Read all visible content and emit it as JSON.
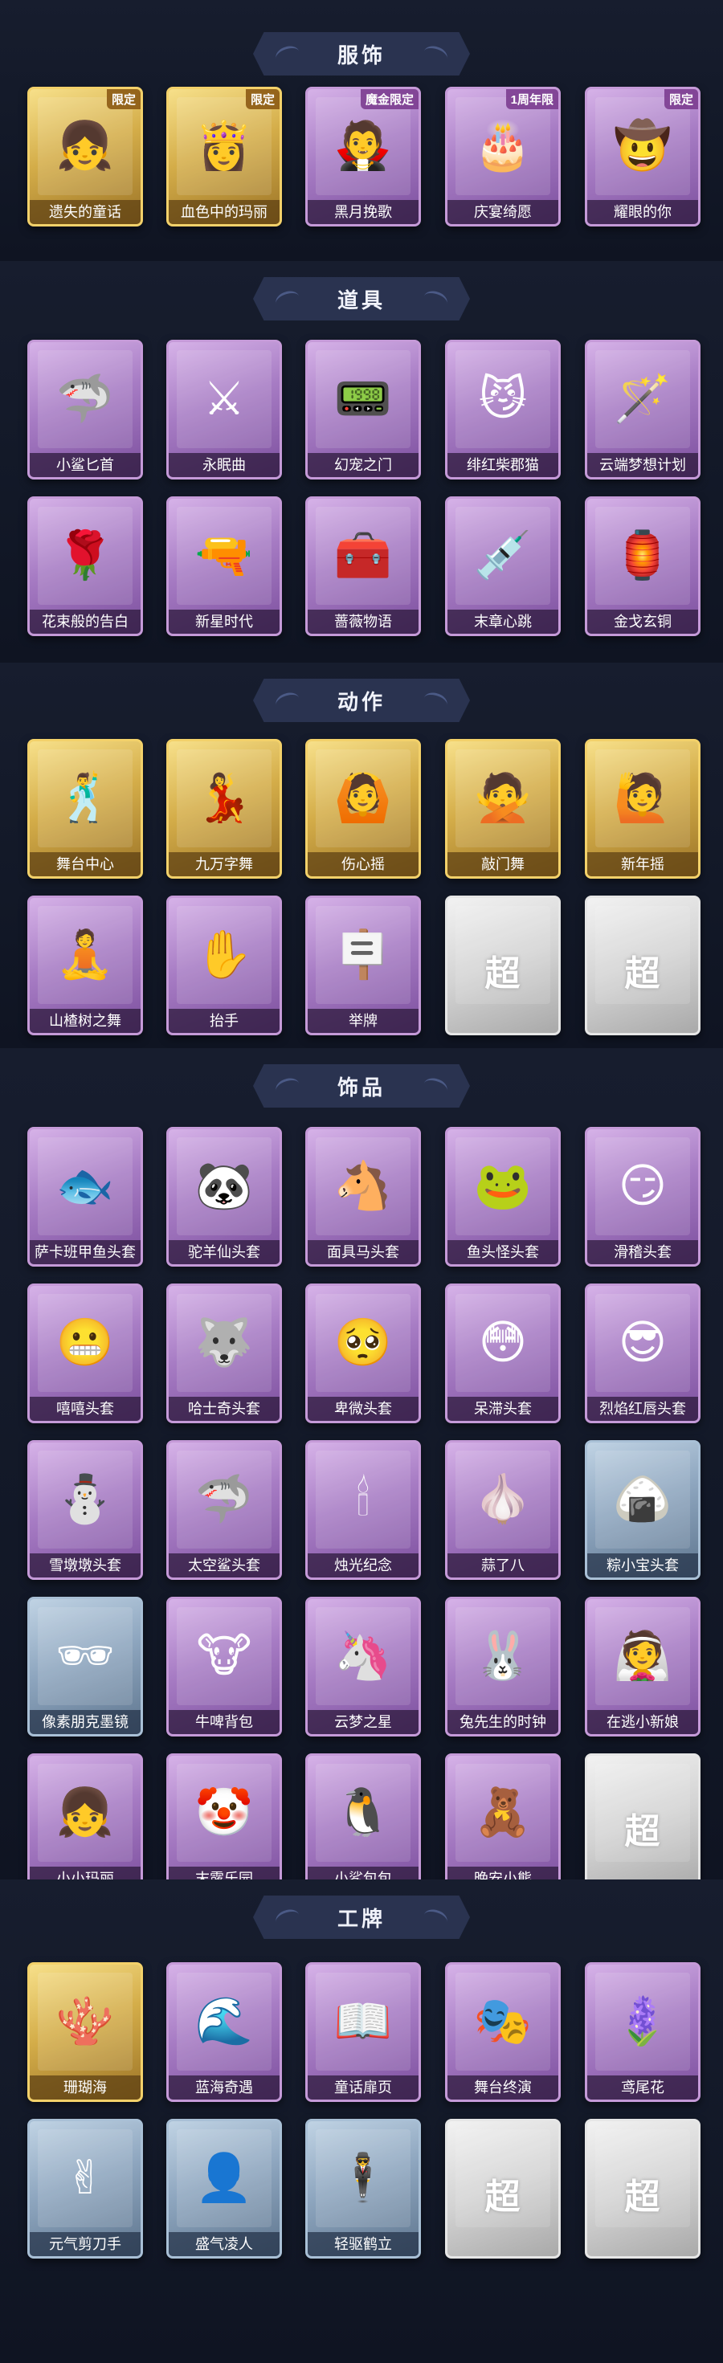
{
  "sections": [
    {
      "id": "costumes",
      "title": "服饰",
      "items": [
        {
          "label": "遗失的童话",
          "badge": "限定",
          "tier": "gold",
          "icon": "fairy-girl-icon",
          "glyph": "👧"
        },
        {
          "label": "血色中的玛丽",
          "badge": "限定",
          "tier": "gold",
          "icon": "mary-icon",
          "glyph": "👸"
        },
        {
          "label": "黑月挽歌",
          "badge": "魔金限定",
          "tier": "purple",
          "icon": "black-moon-icon",
          "glyph": "🧛"
        },
        {
          "label": "庆宴绮愿",
          "badge": "1周年限",
          "tier": "purple",
          "icon": "cake-girl-icon",
          "glyph": "🎂"
        },
        {
          "label": "耀眼的你",
          "badge": "限定",
          "tier": "purple",
          "icon": "cowgirl-icon",
          "glyph": "🤠"
        }
      ]
    },
    {
      "id": "props",
      "title": "道具",
      "items": [
        {
          "label": "小鲨匕首",
          "tier": "purple",
          "icon": "shark-dagger-icon",
          "glyph": "🦈"
        },
        {
          "label": "永眠曲",
          "tier": "purple",
          "icon": "sword-icon",
          "glyph": "⚔"
        },
        {
          "label": "幻宠之门",
          "tier": "purple",
          "icon": "pet-gate-icon",
          "glyph": "📟"
        },
        {
          "label": "绯红柴郡猫",
          "tier": "purple",
          "icon": "cheshire-cat-icon",
          "glyph": "😼"
        },
        {
          "label": "云端梦想计划",
          "tier": "purple",
          "icon": "magic-wand-icon",
          "glyph": "🪄"
        },
        {
          "label": "花束般的告白",
          "tier": "purple",
          "icon": "rose-icon",
          "glyph": "🌹"
        },
        {
          "label": "新星时代",
          "tier": "purple",
          "icon": "revolver-icon",
          "glyph": "🔫"
        },
        {
          "label": "蔷薇物语",
          "tier": "purple",
          "icon": "medkit-icon",
          "glyph": "🧰"
        },
        {
          "label": "末章心跳",
          "tier": "purple",
          "icon": "syringe-icon",
          "glyph": "💉"
        },
        {
          "label": "金戈玄铜",
          "tier": "purple",
          "icon": "lantern-icon",
          "glyph": "🏮"
        }
      ]
    },
    {
      "id": "actions",
      "title": "动作",
      "items": [
        {
          "label": "舞台中心",
          "tier": "gold",
          "icon": "dance-pose-icon",
          "glyph": "🕺"
        },
        {
          "label": "九万字舞",
          "tier": "gold",
          "icon": "dance-pose-icon",
          "glyph": "💃"
        },
        {
          "label": "伤心摇",
          "tier": "gold",
          "icon": "dance-pose-icon",
          "glyph": "🙆"
        },
        {
          "label": "敲门舞",
          "tier": "gold",
          "icon": "dance-pose-icon",
          "glyph": "🙅"
        },
        {
          "label": "新年摇",
          "tier": "gold",
          "icon": "dance-pose-icon",
          "glyph": "🙋"
        },
        {
          "label": "山楂树之舞",
          "tier": "purple",
          "icon": "dance-pose-icon",
          "glyph": "🧘"
        },
        {
          "label": "抬手",
          "tier": "purple",
          "icon": "raise-hand-icon",
          "glyph": "✋"
        },
        {
          "label": "举牌",
          "tier": "purple",
          "icon": "hold-sign-icon",
          "glyph": "🪧"
        },
        {
          "label": "",
          "tier": "gray",
          "icon": "locked-placeholder-icon",
          "locked_text": "超",
          "locked_sub": ""
        },
        {
          "label": "",
          "tier": "gray",
          "icon": "locked-placeholder-icon",
          "locked_text": "超",
          "locked_sub": ""
        }
      ]
    },
    {
      "id": "accessories",
      "title": "饰品",
      "items": [
        {
          "label": "萨卡班甲鱼头套",
          "tier": "purple",
          "icon": "fish-head-icon",
          "glyph": "🐟"
        },
        {
          "label": "驼羊仙头套",
          "tier": "purple",
          "icon": "panda-head-icon",
          "glyph": "🐼"
        },
        {
          "label": "面具马头套",
          "tier": "purple",
          "icon": "horse-head-icon",
          "glyph": "🐴"
        },
        {
          "label": "鱼头怪头套",
          "tier": "purple",
          "icon": "fishman-head-icon",
          "glyph": "🐸"
        },
        {
          "label": "滑稽头套",
          "tier": "purple",
          "icon": "funny-face-icon",
          "glyph": "😏"
        },
        {
          "label": "嘻嘻头套",
          "tier": "purple",
          "icon": "grin-face-icon",
          "glyph": "😬"
        },
        {
          "label": "哈士奇头套",
          "tier": "purple",
          "icon": "husky-head-icon",
          "glyph": "🐺"
        },
        {
          "label": "卑微头套",
          "tier": "purple",
          "icon": "humble-face-icon",
          "glyph": "🥺"
        },
        {
          "label": "呆滞头套",
          "tier": "purple",
          "icon": "dull-face-icon",
          "glyph": "😳"
        },
        {
          "label": "烈焰红唇头套",
          "tier": "purple",
          "icon": "pikachu-head-icon",
          "glyph": "😎"
        },
        {
          "label": "雪墩墩头套",
          "tier": "purple",
          "icon": "snowman-head-icon",
          "glyph": "⛄"
        },
        {
          "label": "太空鲨头套",
          "tier": "purple",
          "icon": "space-shark-icon",
          "glyph": "🦈"
        },
        {
          "label": "烛光纪念",
          "tier": "purple",
          "icon": "candle-icon",
          "glyph": "🕯"
        },
        {
          "label": "蒜了八",
          "tier": "purple",
          "icon": "garlic-icon",
          "glyph": "🧄"
        },
        {
          "label": "粽小宝头套",
          "tier": "blue",
          "icon": "zongzi-head-icon",
          "glyph": "🍙"
        },
        {
          "label": "像素朋克墨镜",
          "tier": "blue",
          "icon": "pixel-glasses-icon",
          "glyph": "🕶"
        },
        {
          "label": "牛啤背包",
          "tier": "purple",
          "icon": "cow-backpack-icon",
          "glyph": "🐮"
        },
        {
          "label": "云梦之星",
          "tier": "purple",
          "icon": "unicorn-icon",
          "glyph": "🦄"
        },
        {
          "label": "兔先生的时钟",
          "tier": "purple",
          "icon": "rabbit-clock-icon",
          "glyph": "🐰"
        },
        {
          "label": "在逃小新娘",
          "tier": "purple",
          "icon": "bride-icon",
          "glyph": "👰"
        },
        {
          "label": "小小玛丽",
          "tier": "purple",
          "icon": "little-mary-icon",
          "glyph": "👧"
        },
        {
          "label": "末露乐园",
          "tier": "purple",
          "icon": "clown-girl-icon",
          "glyph": "🤡"
        },
        {
          "label": "小鲨包包",
          "tier": "purple",
          "icon": "shark-bag-icon",
          "glyph": "🐧"
        },
        {
          "label": "晚安小熊",
          "tier": "purple",
          "icon": "teddy-bear-icon",
          "glyph": "🧸"
        },
        {
          "label": "",
          "tier": "gray",
          "icon": "locked-placeholder-icon",
          "locked_text": "超",
          "locked_sub": ""
        }
      ]
    },
    {
      "id": "badges",
      "title": "工牌",
      "items": [
        {
          "label": "珊瑚海",
          "tier": "gold",
          "icon": "coral-card-icon",
          "glyph": "🪸"
        },
        {
          "label": "蓝海奇遇",
          "tier": "purple",
          "icon": "sea-card-icon",
          "glyph": "🌊"
        },
        {
          "label": "童话扉页",
          "tier": "purple",
          "icon": "fairy-card-icon",
          "glyph": "📖"
        },
        {
          "label": "舞台终演",
          "tier": "purple",
          "icon": "stage-card-icon",
          "glyph": "🎭"
        },
        {
          "label": "鸢尾花",
          "tier": "purple",
          "icon": "iris-card-icon",
          "glyph": "🪻"
        },
        {
          "label": "元气剪刀手",
          "tier": "blue",
          "icon": "silhouette-card-icon",
          "glyph": "✌"
        },
        {
          "label": "盛气凌人",
          "tier": "blue",
          "icon": "silhouette-card-icon",
          "glyph": "👤"
        },
        {
          "label": "轻驱鹤立",
          "tier": "blue",
          "icon": "silhouette-card-icon",
          "glyph": "🕴"
        },
        {
          "label": "",
          "tier": "gray",
          "icon": "locked-placeholder-icon",
          "locked_text": "超",
          "locked_sub": ""
        },
        {
          "label": "",
          "tier": "gray",
          "icon": "locked-placeholder-icon",
          "locked_text": "超",
          "locked_sub": ""
        }
      ]
    }
  ]
}
